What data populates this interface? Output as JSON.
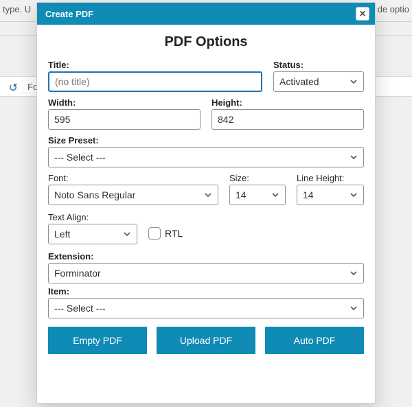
{
  "bg": {
    "left_hint": "type. U",
    "right_hint": "de optio",
    "font_hint": "Fon",
    "redo_icon": "↻"
  },
  "dialog": {
    "header": "Create PDF",
    "close_glyph": "✕",
    "title": "PDF Options",
    "fields": {
      "title": {
        "label": "Title:",
        "placeholder": "(no title)",
        "value": ""
      },
      "status": {
        "label": "Status:",
        "value": "Activated"
      },
      "width": {
        "label": "Width:",
        "value": "595"
      },
      "height": {
        "label": "Height:",
        "value": "842"
      },
      "size_preset": {
        "label": "Size Preset:",
        "value": "--- Select ---"
      },
      "font": {
        "label": "Font:",
        "value": "Noto Sans Regular"
      },
      "size": {
        "label": "Size:",
        "value": "14"
      },
      "line_height": {
        "label": "Line Height:",
        "value": "14"
      },
      "text_align": {
        "label": "Text Align:",
        "value": "Left"
      },
      "rtl": {
        "label": "RTL",
        "checked": false
      },
      "extension": {
        "label": "Extension:",
        "value": "Forminator"
      },
      "item": {
        "label": "Item:",
        "value": "--- Select ---"
      }
    },
    "actions": {
      "empty": "Empty PDF",
      "upload": "Upload PDF",
      "auto": "Auto PDF"
    }
  }
}
